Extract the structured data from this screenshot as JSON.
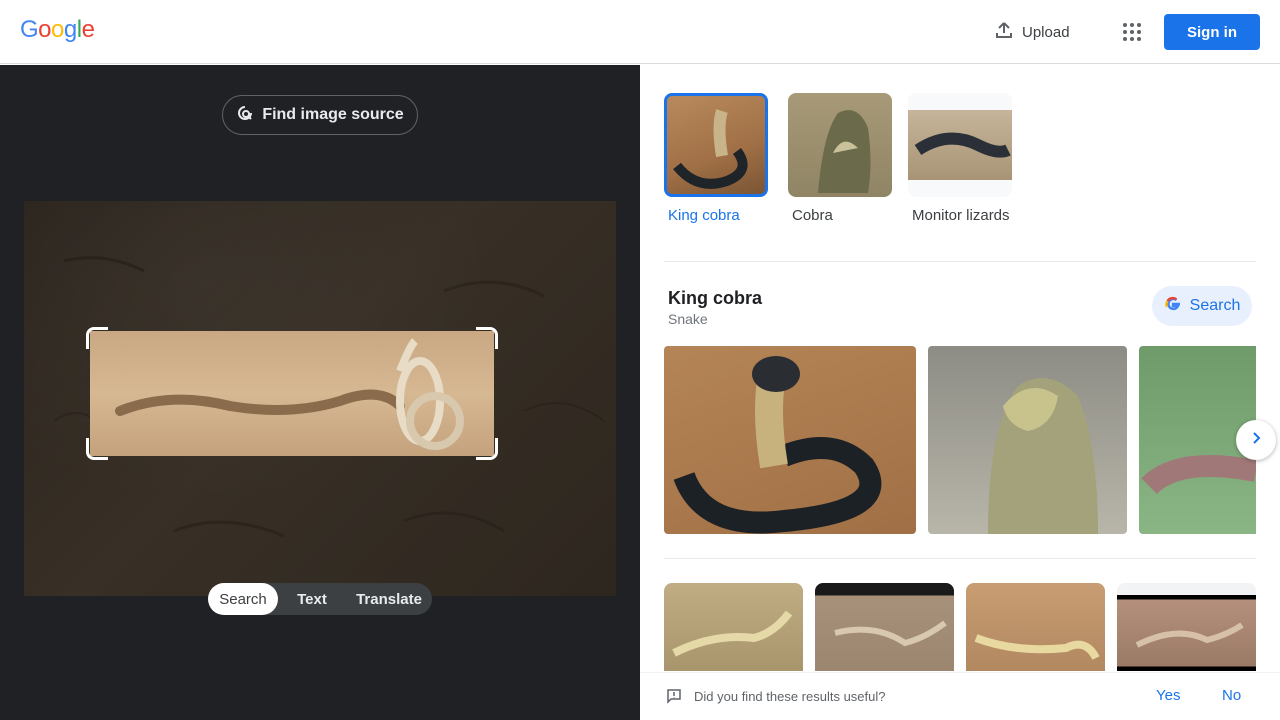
{
  "header": {
    "logo_letters": [
      {
        "ch": "G",
        "color": "#4285f4"
      },
      {
        "ch": "o",
        "color": "#ea4335"
      },
      {
        "ch": "o",
        "color": "#fbbc05"
      },
      {
        "ch": "g",
        "color": "#4285f4"
      },
      {
        "ch": "l",
        "color": "#34a853"
      },
      {
        "ch": "e",
        "color": "#ea4335"
      }
    ],
    "upload_label": "Upload",
    "apps_icon": "apps-grid-icon",
    "signin_label": "Sign in",
    "accent": "#1a73e8"
  },
  "left_panel": {
    "find_source_label": "Find image source",
    "find_source_icon": "lens-search-icon",
    "modes": [
      "Search",
      "Text",
      "Translate"
    ],
    "active_mode": "Search"
  },
  "results": {
    "chips": [
      {
        "label": "King cobra",
        "active": true
      },
      {
        "label": "Cobra",
        "active": false
      },
      {
        "label": "Monitor lizards",
        "active": false
      }
    ],
    "knowledge": {
      "title": "King cobra",
      "subtitle": "Snake",
      "search_label": "Search"
    },
    "feedback": {
      "question": "Did you find these results useful?",
      "yes": "Yes",
      "no": "No"
    }
  }
}
